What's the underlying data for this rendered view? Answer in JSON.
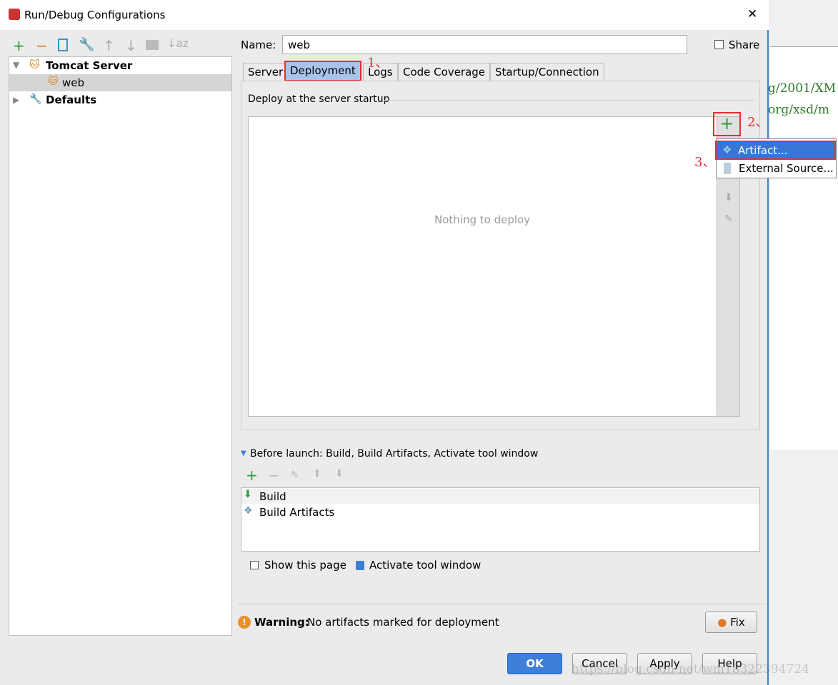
{
  "window": {
    "title": "Run/Debug Configurations",
    "close": "✕"
  },
  "background_code": [
    "g/2001/XM",
    "org/xsd/m"
  ],
  "toolbar": {
    "add": "+",
    "remove": "−",
    "copy": "copy",
    "edit": "wrench",
    "up": "↑",
    "down": "↓",
    "folder": "folder",
    "sort": "↓az"
  },
  "tree": {
    "items": [
      {
        "label": "Tomcat Server",
        "expanded": true
      },
      {
        "label": "web",
        "selected": true
      },
      {
        "label": "Defaults",
        "expanded": false
      }
    ]
  },
  "name": {
    "label": "Name:",
    "value": "web"
  },
  "share": {
    "label": "Share",
    "checked": false
  },
  "tabs": [
    {
      "label": "Server"
    },
    {
      "label": "Deployment",
      "active": true
    },
    {
      "label": "Logs"
    },
    {
      "label": "Code Coverage"
    },
    {
      "label": "Startup/Connection"
    }
  ],
  "deployment": {
    "section_title": "Deploy at the server startup",
    "empty_text": "Nothing to deploy",
    "add": "+"
  },
  "popup": {
    "items": [
      {
        "label": "Artifact...",
        "selected": true
      },
      {
        "label": "External Source..."
      }
    ]
  },
  "annotations": [
    "1、",
    "2、",
    "3、"
  ],
  "before_launch": {
    "title": "Before launch: Build, Build Artifacts, Activate tool window",
    "items": [
      "Build",
      "Build Artifacts"
    ]
  },
  "show_page": {
    "label": "Show this page",
    "checked": false
  },
  "activate": {
    "label": "Activate tool window",
    "checked": true
  },
  "warning": {
    "bold": "Warning:",
    "text": "No artifacts marked for deployment",
    "fix": "Fix"
  },
  "buttons": {
    "ok": "OK",
    "cancel": "Cancel",
    "apply": "Apply",
    "help": "Help"
  },
  "watermark": "https://blog.csdn.net/wm18322394724",
  "colors": {
    "accent": "#3b7fd6",
    "annotation": "#e53030",
    "add": "#2e9b3a"
  }
}
